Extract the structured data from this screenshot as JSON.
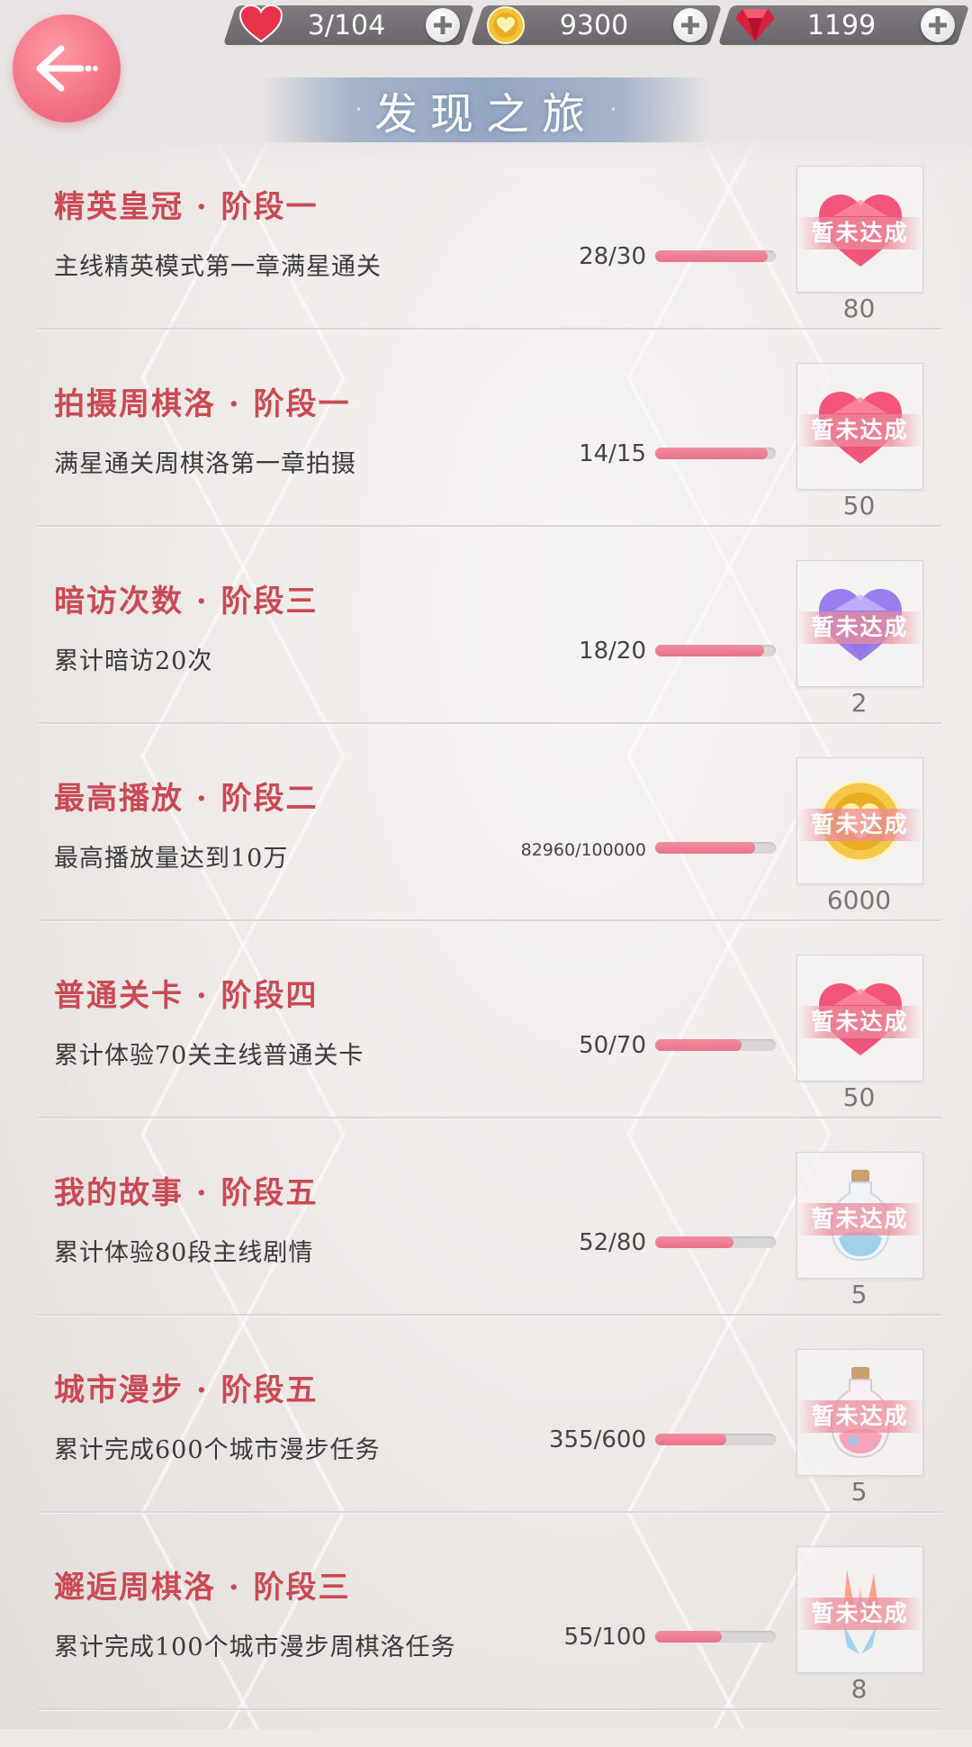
{
  "header": {
    "title": "发现之旅",
    "stamina": "3/104",
    "gold": "9300",
    "diamond": "1199"
  },
  "colors": {
    "accent": "#e9738a",
    "title_red": "#c94a55"
  },
  "tasks": [
    {
      "title": "精英皇冠 · 阶段一",
      "desc": "主线精英模式第一章满星通关",
      "progress": "28/30",
      "fraction": 0.933,
      "reward_icon": "pink-diamond-icon",
      "reward_count": "80",
      "status": "暂未达成"
    },
    {
      "title": "拍摄周棋洛 · 阶段一",
      "desc": "满星通关周棋洛第一章拍摄",
      "progress": "14/15",
      "fraction": 0.933,
      "reward_icon": "pink-diamond-icon",
      "reward_count": "50",
      "status": "暂未达成"
    },
    {
      "title": "暗访次数 · 阶段三",
      "desc": "累计暗访20次",
      "progress": "18/20",
      "fraction": 0.9,
      "reward_icon": "purple-heart-gem-icon",
      "reward_count": "2",
      "status": "暂未达成"
    },
    {
      "title": "最高播放 · 阶段二",
      "desc": "最高播放量达到10万",
      "progress": "82960/100000",
      "fraction": 0.83,
      "reward_icon": "gold-coin-icon",
      "reward_count": "6000",
      "status": "暂未达成"
    },
    {
      "title": "普通关卡 · 阶段四",
      "desc": "累计体验70关主线普通关卡",
      "progress": "50/70",
      "fraction": 0.714,
      "reward_icon": "pink-diamond-icon",
      "reward_count": "50",
      "status": "暂未达成"
    },
    {
      "title": "我的故事 · 阶段五",
      "desc": "累计体验80段主线剧情",
      "progress": "52/80",
      "fraction": 0.65,
      "reward_icon": "blue-bottle-icon",
      "reward_count": "5",
      "status": "暂未达成"
    },
    {
      "title": "城市漫步 · 阶段五",
      "desc": "累计完成600个城市漫步任务",
      "progress": "355/600",
      "fraction": 0.592,
      "reward_icon": "pink-bottle-icon",
      "reward_count": "5",
      "status": "暂未达成"
    },
    {
      "title": "邂逅周棋洛 · 阶段三",
      "desc": "累计完成100个城市漫步周棋洛任务",
      "progress": "55/100",
      "fraction": 0.55,
      "reward_icon": "crystal-icon",
      "reward_count": "8",
      "status": "暂未达成"
    }
  ]
}
